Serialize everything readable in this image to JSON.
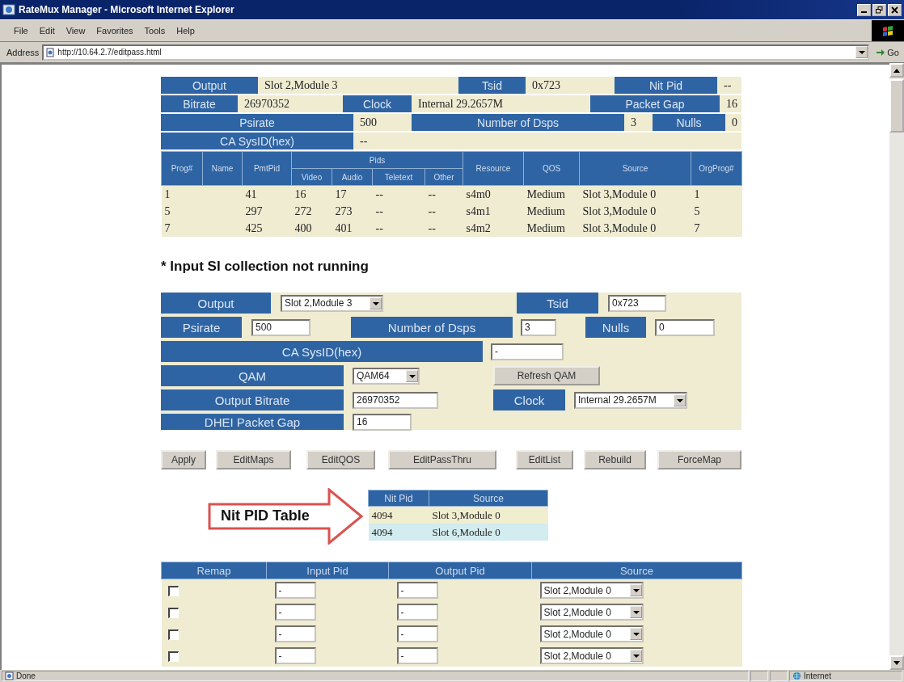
{
  "window": {
    "title": "RateMux Manager - Microsoft Internet Explorer"
  },
  "menu": [
    "File",
    "Edit",
    "View",
    "Favorites",
    "Tools",
    "Help"
  ],
  "address_bar": {
    "label": "Address",
    "url": "http://10.64.2.7/editpass.html",
    "go": "Go"
  },
  "summary": {
    "rows": [
      [
        {
          "label": "Output",
          "value": "Slot 2,Module 3"
        },
        {
          "label": "Tsid",
          "value": "0x723"
        },
        {
          "label": "Nit Pid",
          "value": "--"
        }
      ],
      [
        {
          "label": "Bitrate",
          "value": "26970352"
        },
        {
          "label": "Clock",
          "value": "Internal 29.2657M"
        },
        {
          "label": "Packet Gap",
          "value": "16"
        }
      ],
      [
        {
          "label": "Psirate",
          "value": "500"
        },
        {
          "label": "Number of Dsps",
          "value": "3"
        },
        {
          "label": "Nulls",
          "value": "0"
        }
      ],
      [
        {
          "label": "CA SysID(hex)",
          "value": "--"
        }
      ]
    ]
  },
  "programs": {
    "group_header": "Pids",
    "columns": [
      {
        "label": "Prog#",
        "grouped": false
      },
      {
        "label": "Name",
        "grouped": false
      },
      {
        "label": "PmtPid",
        "grouped": false
      },
      {
        "label": "Video",
        "grouped": true
      },
      {
        "label": "Audio",
        "grouped": true
      },
      {
        "label": "Teletext",
        "grouped": true
      },
      {
        "label": "Other",
        "grouped": true
      },
      {
        "label": "Resource",
        "grouped": false
      },
      {
        "label": "QOS",
        "grouped": false
      },
      {
        "label": "Source",
        "grouped": false
      },
      {
        "label": "OrgProg#",
        "grouped": false
      }
    ],
    "rows": [
      [
        "1",
        null,
        "41",
        "16",
        "17",
        "--",
        "--",
        "s4m0",
        "Medium",
        "Slot 3,Module 0",
        "1"
      ],
      [
        "5",
        null,
        "297",
        "272",
        "273",
        "--",
        "--",
        "s4m1",
        "Medium",
        "Slot 3,Module 0",
        "5"
      ],
      [
        "7",
        null,
        "425",
        "400",
        "401",
        "--",
        "--",
        "s4m2",
        "Medium",
        "Slot 3,Module 0",
        "7"
      ]
    ]
  },
  "note": "* Input SI collection not running",
  "form": {
    "lines": [
      {
        "items": [
          {
            "kind": "label",
            "text": "Output"
          },
          {
            "kind": "select",
            "value": "Slot 2,Module 3"
          },
          {
            "kind": "label",
            "text": "Tsid"
          },
          {
            "kind": "input",
            "value": "0x723"
          }
        ]
      },
      {
        "items": [
          {
            "kind": "label",
            "text": "Psirate"
          },
          {
            "kind": "input",
            "value": "500"
          },
          {
            "kind": "label",
            "text": "Number of Dsps"
          },
          {
            "kind": "input",
            "value": "3"
          },
          {
            "kind": "label",
            "text": "Nulls"
          },
          {
            "kind": "input",
            "value": "0"
          }
        ]
      },
      {
        "items": [
          {
            "kind": "label",
            "text": "CA SysID(hex)"
          },
          {
            "kind": "input",
            "value": "-"
          }
        ]
      },
      {
        "items": [
          {
            "kind": "label",
            "text": "QAM"
          },
          {
            "kind": "select",
            "value": "QAM64"
          },
          {
            "kind": "button",
            "text": "Refresh QAM"
          }
        ]
      },
      {
        "items": [
          {
            "kind": "label",
            "text": "Output Bitrate"
          },
          {
            "kind": "input",
            "value": "26970352"
          },
          {
            "kind": "label",
            "text": "Clock"
          },
          {
            "kind": "select",
            "value": "Internal 29.2657M"
          }
        ]
      },
      {
        "items": [
          {
            "kind": "label",
            "text": "DHEI Packet Gap"
          },
          {
            "kind": "input",
            "value": "16"
          }
        ]
      }
    ]
  },
  "buttons": [
    "Apply",
    "EditMaps",
    "EditQOS",
    "EditPassThru",
    "EditList",
    "Rebuild",
    "ForceMap"
  ],
  "callout": {
    "text": "Nit PID Table"
  },
  "nit_table": {
    "columns": [
      "Nit Pid",
      "Source"
    ],
    "rows": [
      {
        "cells": [
          "4094",
          "Slot 3,Module 0"
        ],
        "color": "#f1edcf"
      },
      {
        "cells": [
          "4094",
          "Slot 6,Module 0"
        ],
        "color": "#d3ecef"
      }
    ]
  },
  "remap": {
    "columns": [
      "Remap",
      "Input Pid",
      "Output Pid",
      "Source"
    ],
    "rows": [
      {
        "checked": false,
        "input_pid": "-",
        "output_pid": "-",
        "source": "Slot 2,Module 0"
      },
      {
        "checked": false,
        "input_pid": "-",
        "output_pid": "-",
        "source": "Slot 2,Module 0"
      },
      {
        "checked": false,
        "input_pid": "-",
        "output_pid": "-",
        "source": "Slot 2,Module 0"
      },
      {
        "checked": false,
        "input_pid": "-",
        "output_pid": "-",
        "source": "Slot 2,Module 0"
      }
    ]
  },
  "status_bar": {
    "text": "Done",
    "zone": "Internet"
  }
}
